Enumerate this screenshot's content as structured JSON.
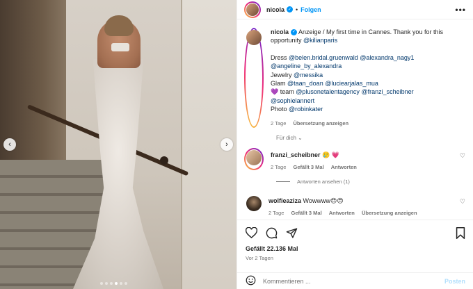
{
  "colors": {
    "accent": "#0095f6",
    "link": "#00376b",
    "muted": "#737373",
    "heart": "#ed4956"
  },
  "header": {
    "username": "nicola",
    "follow_label": "Folgen",
    "bullet": "•",
    "more": "•••"
  },
  "carousel": {
    "prev": "‹",
    "next": "›",
    "dot_count": 6,
    "active_index": 3
  },
  "caption": {
    "username": "nicola",
    "line1": "Anzeige / My first time in Cannes. Thank you for this opportunity ",
    "mention_kilian": "@kilianparis",
    "dress_label": "Dress ",
    "dress_m1": "@belen.bridal.gruenwald",
    "dress_m2": "@alexandra_nagy1",
    "dress_m3": "@angeline_by_alexandra",
    "jewelry_label": "Jewelry ",
    "jewelry_m1": "@messika",
    "glam_label": "Glam ",
    "glam_m1": "@taan_doan",
    "glam_m2": "@luciearjalas_mua",
    "team_heart": "💜",
    "team_label": " team ",
    "team_m1": "@plusonetalentagency",
    "team_m2": "@franzi_scheibner",
    "team_m3": "@sophielannert",
    "photo_label": "Photo ",
    "photo_m1": "@robinkater",
    "time": "2 Tage",
    "translate": "Übersetzung anzeigen"
  },
  "fuer_dich": "Für dich",
  "comments": [
    {
      "username": "franzi_scheibner",
      "text": "🥲 💗",
      "time": "2 Tage",
      "likes": "Gefällt 3 Mal",
      "reply": "Antworten",
      "view_replies": "Antworten ansehen (1)"
    },
    {
      "username": "wolfieaziza",
      "text": "Wowwww😍😍",
      "time": "2 Tage",
      "likes": "Gefällt 3 Mal",
      "reply": "Antworten",
      "translate": "Übersetzung anzeigen"
    }
  ],
  "actions": {
    "likes": "Gefällt 22.136 Mal",
    "date": "Vor 2 Tagen"
  },
  "comment_box": {
    "placeholder": "Kommentieren ...",
    "post": "Posten"
  }
}
